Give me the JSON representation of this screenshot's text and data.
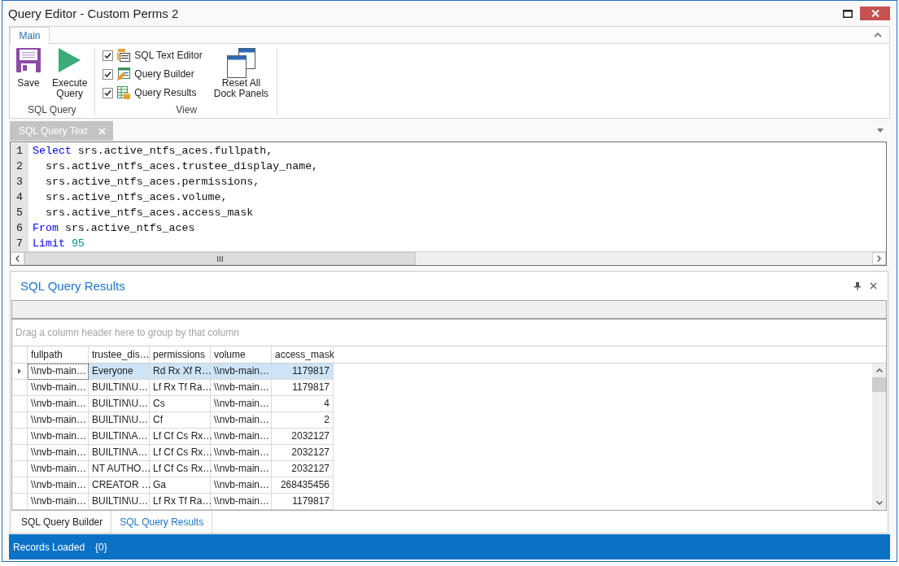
{
  "window": {
    "title": "Query Editor - Custom Perms 2"
  },
  "ribbon": {
    "tabs": [
      {
        "label": "Main",
        "selected": true
      }
    ],
    "groups": [
      {
        "label": "SQL Query",
        "items": [
          {
            "kind": "save",
            "label": "Save"
          },
          {
            "kind": "execute",
            "label": "Execute\nQuery"
          }
        ]
      },
      {
        "label": "View",
        "checks": [
          {
            "kind": "editor",
            "label": "SQL Text Editor",
            "checked": true
          },
          {
            "kind": "builder",
            "label": "Query Builder",
            "checked": true
          },
          {
            "kind": "results",
            "label": "Query Results",
            "checked": true
          }
        ],
        "items": [
          {
            "kind": "reset",
            "label": "Reset All\nDock Panels"
          }
        ]
      }
    ]
  },
  "document_tabs": [
    {
      "label": "SQL Query Text",
      "selected": true
    }
  ],
  "editor": {
    "lines": [
      {
        "number": "1",
        "tokens": [
          {
            "kind": "keyword",
            "text": "Select"
          },
          {
            "kind": "plain",
            "text": " srs.active_ntfs_aces.fullpath,"
          }
        ]
      },
      {
        "number": "2",
        "tokens": [
          {
            "kind": "plain",
            "text": "  srs.active_ntfs_aces.trustee_display_name,"
          }
        ]
      },
      {
        "number": "3",
        "tokens": [
          {
            "kind": "plain",
            "text": "  srs.active_ntfs_aces.permissions,"
          }
        ]
      },
      {
        "number": "4",
        "tokens": [
          {
            "kind": "plain",
            "text": "  srs.active_ntfs_aces.volume,"
          }
        ]
      },
      {
        "number": "5",
        "tokens": [
          {
            "kind": "plain",
            "text": "  srs.active_ntfs_aces.access_mask"
          }
        ]
      },
      {
        "number": "6",
        "tokens": [
          {
            "kind": "keyword",
            "text": "From"
          },
          {
            "kind": "plain",
            "text": " srs.active_ntfs_aces"
          }
        ]
      },
      {
        "number": "7",
        "tokens": [
          {
            "kind": "keyword",
            "text": "Limit"
          },
          {
            "kind": "number",
            "text": " 95"
          }
        ]
      }
    ]
  },
  "results_panel": {
    "title": "SQL Query Results",
    "hint": "Drag a column header here to group by that column",
    "columns": [
      {
        "label": "fullpath",
        "kind": "text"
      },
      {
        "label": "trustee_dis…",
        "kind": "text"
      },
      {
        "label": "permissions",
        "kind": "text"
      },
      {
        "label": "volume",
        "kind": "text"
      },
      {
        "label": "access_mask",
        "kind": "number"
      }
    ],
    "rows": [
      {
        "selected": true,
        "cells": [
          "\\\\nvb-main…",
          "Everyone",
          "Rd Rx Xf R…",
          "\\\\nvb-main…",
          "1179817"
        ]
      },
      {
        "selected": false,
        "cells": [
          "\\\\nvb-main…",
          "BUILTIN\\U…",
          "Lf Rx Tf Ra…",
          "\\\\nvb-main…",
          "1179817"
        ]
      },
      {
        "selected": false,
        "cells": [
          "\\\\nvb-main…",
          "BUILTIN\\U…",
          "Cs",
          "\\\\nvb-main…",
          "4"
        ]
      },
      {
        "selected": false,
        "cells": [
          "\\\\nvb-main…",
          "BUILTIN\\U…",
          "Cf",
          "\\\\nvb-main…",
          "2"
        ]
      },
      {
        "selected": false,
        "cells": [
          "\\\\nvb-main…",
          "BUILTIN\\A…",
          "Lf Cf Cs Rx…",
          "\\\\nvb-main…",
          "2032127"
        ]
      },
      {
        "selected": false,
        "cells": [
          "\\\\nvb-main…",
          "BUILTIN\\A…",
          "Lf Cf Cs Rx…",
          "\\\\nvb-main…",
          "2032127"
        ]
      },
      {
        "selected": false,
        "cells": [
          "\\\\nvb-main…",
          "NT AUTHO…",
          "Lf Cf Cs Rx…",
          "\\\\nvb-main…",
          "2032127"
        ]
      },
      {
        "selected": false,
        "cells": [
          "\\\\nvb-main…",
          "CREATOR …",
          "Ga",
          "\\\\nvb-main…",
          "268435456"
        ]
      },
      {
        "selected": false,
        "cells": [
          "\\\\nvb-main…",
          "BUILTIN\\U…",
          "Lf Rx Tf Ra…",
          "\\\\nvb-main…",
          "1179817"
        ]
      }
    ]
  },
  "bottom_tabs": [
    {
      "label": "SQL Query Builder",
      "selected": false
    },
    {
      "label": "SQL Query Results",
      "selected": true
    }
  ],
  "status_bar": {
    "items": [
      "Records Loaded",
      "{0}"
    ]
  }
}
